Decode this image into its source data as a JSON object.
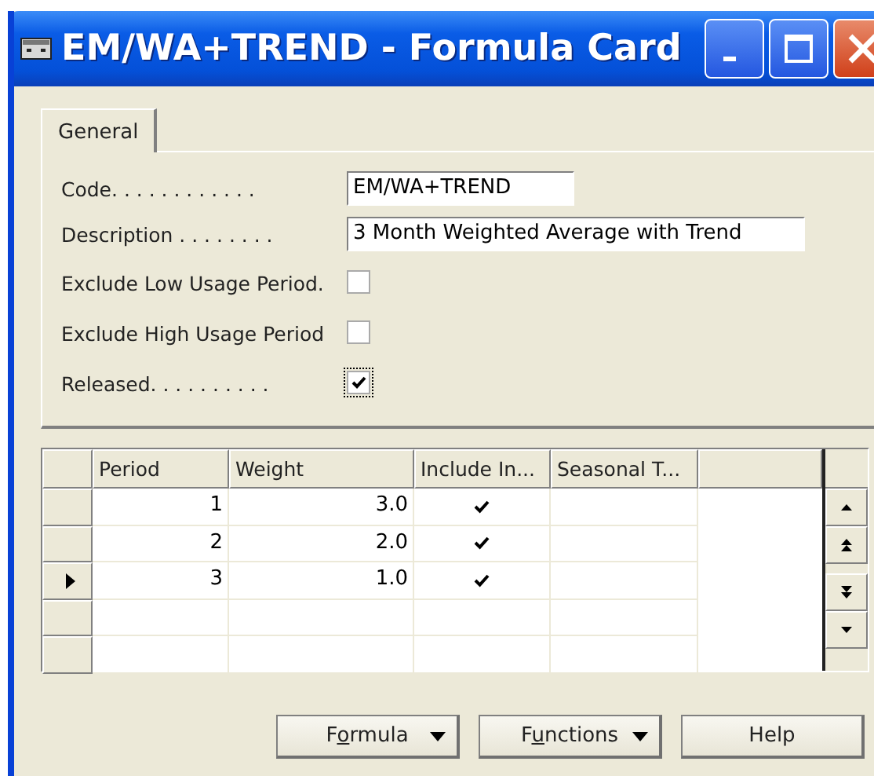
{
  "window": {
    "title": "EM/WA+TREND - Formula Card"
  },
  "tabs": [
    {
      "label": "General",
      "selected": true
    }
  ],
  "fields": [
    {
      "kind": "text",
      "label": "Code. . . . . . . . . . . .",
      "value": "EM/WA+TREND"
    },
    {
      "kind": "text",
      "label": "Description . . . . . . . .",
      "value": "3 Month Weighted Average with Trend"
    },
    {
      "kind": "checkbox",
      "label": "Exclude Low Usage Period.",
      "checked": false
    },
    {
      "kind": "checkbox",
      "label": "Exclude High Usage Period",
      "checked": false
    },
    {
      "kind": "checkbox",
      "label": "Released. . . . . . . . . .",
      "checked": true
    }
  ],
  "table": {
    "columns": [
      "Period",
      "Weight",
      "Include In...",
      "Seasonal T..."
    ],
    "rows": [
      {
        "period": "1",
        "weight": "3.0",
        "include": true,
        "current": false
      },
      {
        "period": "2",
        "weight": "2.0",
        "include": true,
        "current": false
      },
      {
        "period": "3",
        "weight": "1.0",
        "include": true,
        "current": true
      }
    ]
  },
  "buttons": [
    {
      "label_parts": [
        "F",
        "o",
        "rmula"
      ],
      "dropdown": true
    },
    {
      "label_parts": [
        "F",
        "u",
        "nctions"
      ],
      "dropdown": true
    },
    {
      "label_parts": [
        "Help"
      ],
      "dropdown": false
    }
  ]
}
